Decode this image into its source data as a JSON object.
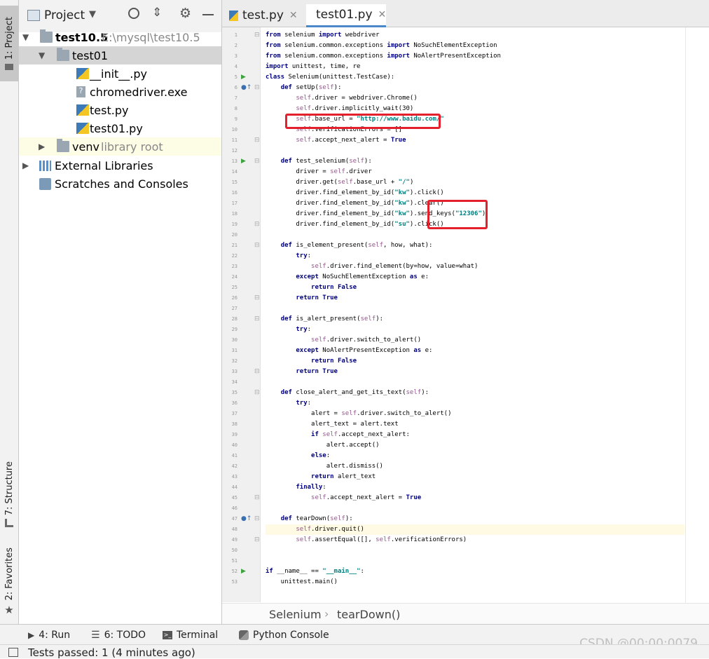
{
  "left_stripe": {
    "project_tab": "1: Project",
    "structure_tab": "7: Structure",
    "favorites_tab": "2: Favorites"
  },
  "project_panel": {
    "title": "Project",
    "tree": [
      {
        "label": "test10.5",
        "extra": "E:\\mysql\\test10.5"
      },
      {
        "label": "test01"
      },
      {
        "label": "__init__.py"
      },
      {
        "label": "chromedriver.exe"
      },
      {
        "label": "test.py"
      },
      {
        "label": "test01.py"
      },
      {
        "label": "venv",
        "extra": "library root"
      },
      {
        "label": "External Libraries"
      },
      {
        "label": "Scratches and Consoles"
      }
    ]
  },
  "editor": {
    "tabs": [
      {
        "label": "test.py"
      },
      {
        "label": "test01.py"
      }
    ],
    "lines": [
      "from selenium import webdriver",
      "from selenium.common.exceptions import NoSuchElementException",
      "from selenium.common.exceptions import NoAlertPresentException",
      "import unittest, time, re",
      "class Selenium(unittest.TestCase):",
      "    def setUp(self):",
      "        self.driver = webdriver.Chrome()",
      "        self.driver.implicitly_wait(30)",
      "        self.base_url = \"http://www.baidu.com/\"",
      "        self.verificationErrors = []",
      "        self.accept_next_alert = True",
      "",
      "    def test_selenium(self):",
      "        driver = self.driver",
      "        driver.get(self.base_url + \"/\")",
      "        driver.find_element_by_id(\"kw\").click()",
      "        driver.find_element_by_id(\"kw\").clear()",
      "        driver.find_element_by_id(\"kw\").send_keys(\"12306\")",
      "        driver.find_element_by_id(\"su\").click()",
      "",
      "    def is_element_present(self, how, what):",
      "        try:",
      "            self.driver.find_element(by=how, value=what)",
      "        except NoSuchElementException as e:",
      "            return False",
      "        return True",
      "",
      "    def is_alert_present(self):",
      "        try:",
      "            self.driver.switch_to_alert()",
      "        except NoAlertPresentException as e:",
      "            return False",
      "        return True",
      "",
      "    def close_alert_and_get_its_text(self):",
      "        try:",
      "            alert = self.driver.switch_to_alert()",
      "            alert_text = alert.text",
      "            if self.accept_next_alert:",
      "                alert.accept()",
      "            else:",
      "                alert.dismiss()",
      "            return alert_text",
      "        finally:",
      "            self.accept_next_alert = True",
      "",
      "    def tearDown(self):",
      "        self.driver.quit()",
      "        self.assertEqual([], self.verificationErrors)",
      "",
      "",
      "if __name__ == \"__main__\":",
      "    unittest.main()"
    ]
  },
  "breadcrumb": {
    "class_name": "Selenium",
    "method": "tearDown()",
    "separator": "›"
  },
  "bottom_tools": {
    "run": "4: Run",
    "todo": "6: TODO",
    "terminal": "Terminal",
    "python_console": "Python Console"
  },
  "status": {
    "message": "Tests passed: 1 (4 minutes ago)"
  },
  "watermark": "CSDN @00:00:0079",
  "colors": {
    "keyword": "#000080",
    "self": "#94558d",
    "string": "#008080",
    "accent": "#4a88c7",
    "annotation": "#e3202b"
  }
}
